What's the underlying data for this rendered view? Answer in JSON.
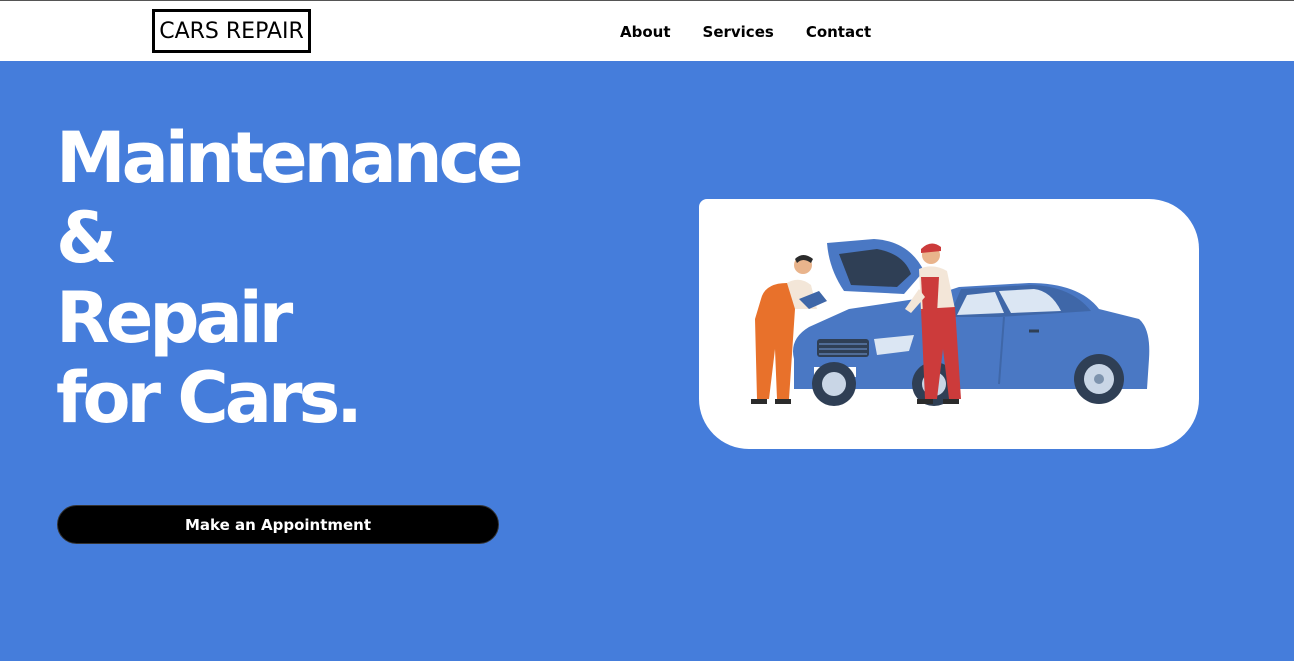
{
  "navbar": {
    "logo": "CARS REPAIR",
    "links": [
      {
        "label": "About"
      },
      {
        "label": "Services"
      },
      {
        "label": "Contact"
      }
    ]
  },
  "hero": {
    "title_lines": [
      "Maintenance",
      "&",
      "Repair",
      "for Cars."
    ],
    "cta_label": "Make an Appointment"
  },
  "colors": {
    "hero_background": "#457ddb",
    "navbar_background": "#ffffff",
    "button_background": "#000000",
    "car_body": "#4a78c4",
    "mechanic_overalls_orange": "#e8712b",
    "mechanic_overalls_red": "#cc3b3b"
  },
  "illustration": {
    "icon": "car-repair-illustration"
  }
}
